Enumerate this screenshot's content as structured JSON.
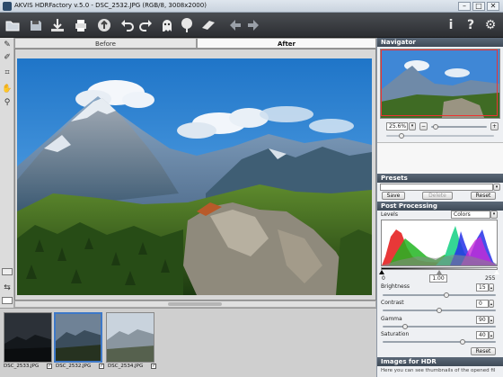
{
  "window": {
    "title": "AKVIS HDRFactory v.5.0 - DSC_2532.JPG (RGB/8, 3008x2000)",
    "minimize": "–",
    "maximize": "□",
    "close": "✕"
  },
  "toolbar": {
    "icons": [
      "open-folder-icon",
      "save-icon",
      "import-icon",
      "print-icon",
      "upload-icon",
      "undo-icon",
      "redo-icon",
      "ghost-icon",
      "tree-icon",
      "tube-icon",
      "arrow-left-icon",
      "arrow-right-icon",
      "info-icon",
      "help-icon",
      "settings-icon"
    ],
    "info": "i",
    "help": "?",
    "settings": "⚙"
  },
  "tabs": {
    "before": "Before",
    "after": "After"
  },
  "navigator": {
    "title": "Navigator",
    "zoom": "25.6%"
  },
  "presets": {
    "title": "Presets",
    "save": "Save",
    "delete": "Delete",
    "reset": "Reset"
  },
  "post": {
    "title": "Post Processing",
    "levels": "Levels",
    "channel": "Colors",
    "in_black": "0",
    "gamma": "1.00",
    "in_white": "255",
    "brightness_label": "Brightness",
    "brightness": "15",
    "contrast_label": "Contrast",
    "contrast": "0",
    "gamma_label": "Gamma",
    "gamma_value": "90",
    "saturation_label": "Saturation",
    "saturation": "40",
    "reset": "Reset"
  },
  "images_for_hdr": {
    "title": "Images for HDR",
    "text": "Here you can see thumbnails of the opened fil"
  },
  "filmstrip": [
    {
      "name": "DSC_2533.JPG"
    },
    {
      "name": "DSC_2532.JPG"
    },
    {
      "name": "DSC_2534.JPG"
    }
  ],
  "colors": {
    "accent": "#3d78c8",
    "panel_header": "#4a5665"
  }
}
